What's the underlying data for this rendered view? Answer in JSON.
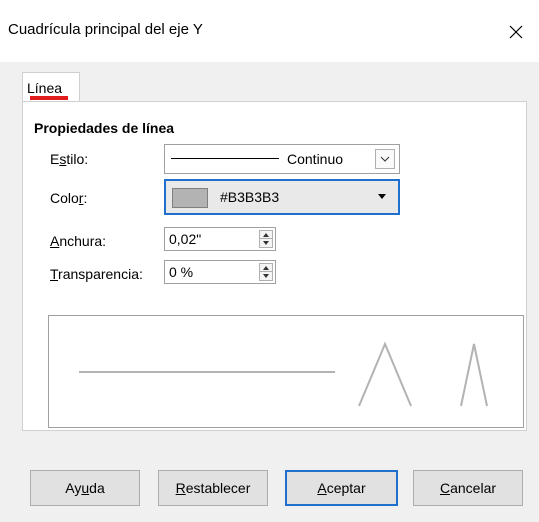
{
  "window": {
    "title": "Cuadrícula principal del eje Y",
    "close_icon": "close-icon"
  },
  "tabs": [
    {
      "label": "Línea",
      "active": true,
      "underline_color": "#e11d1d"
    }
  ],
  "section": {
    "title": "Propiedades de línea"
  },
  "fields": {
    "style": {
      "label_pre": "E",
      "label_acc": "s",
      "label_post": "tilo:",
      "value": "Continuo"
    },
    "color": {
      "label_pre": "Colo",
      "label_acc": "r",
      "label_post": ":",
      "value": "#B3B3B3",
      "swatch": "#b3b3b3",
      "focus_color": "#1f6fce"
    },
    "width": {
      "label_pre": "",
      "label_acc": "A",
      "label_post": "nchura:",
      "value": "0,02\""
    },
    "transparency": {
      "label_pre": "",
      "label_acc": "T",
      "label_post": "ransparencia:",
      "value": "0 %"
    }
  },
  "preview": {
    "line_color": "#b3b3b3"
  },
  "buttons": {
    "help": {
      "pre": "Ay",
      "acc": "u",
      "post": "da"
    },
    "reset": {
      "pre": "",
      "acc": "R",
      "post": "establecer"
    },
    "ok": {
      "pre": "",
      "acc": "A",
      "post": "ceptar"
    },
    "cancel": {
      "pre": "",
      "acc": "C",
      "post": "ancelar"
    }
  }
}
